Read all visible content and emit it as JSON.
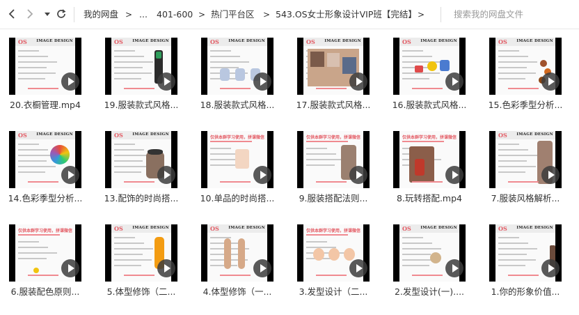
{
  "toolbar": {
    "back_icon": "chevron-left-icon",
    "forward_icon": "chevron-right-icon",
    "history_icon": "triangle-down-icon",
    "refresh_icon": "refresh-icon",
    "breadcrumbs": [
      "我的网盘",
      "...",
      "401-600",
      "热门平台区",
      "543.OS女士形象设计VIP班【完结】"
    ],
    "crumb_separator": ">",
    "search_placeholder": "搜索我的网盘文件"
  },
  "files": [
    {
      "name": "20.衣橱管理.mp4",
      "style": "os-table"
    },
    {
      "name": "19.服装款式风格...",
      "style": "os-dress"
    },
    {
      "name": "18.服装款式风格...",
      "style": "os-collars"
    },
    {
      "name": "17.服装款式风格...",
      "style": "os-collage"
    },
    {
      "name": "16.服装款式风格...",
      "style": "os-items"
    },
    {
      "name": "15.色彩季型分析...",
      "style": "os-palette"
    },
    {
      "name": "14.色彩季型分析...",
      "style": "os-wheel"
    },
    {
      "name": "13.配饰的时尚搭...",
      "style": "os-hat"
    },
    {
      "name": "10.单品的时尚搭...",
      "style": "red-banner-shirt"
    },
    {
      "name": "9.服装搭配法则...",
      "style": "red-banner-person"
    },
    {
      "name": "8.玩转搭配.mp4",
      "style": "red-banner-street"
    },
    {
      "name": "7.服装风格解析...",
      "style": "os-model"
    },
    {
      "name": "6.服装配色原则...",
      "style": "red-banner-dot"
    },
    {
      "name": "5.体型修饰（二...",
      "style": "os-figure"
    },
    {
      "name": "4.体型修饰（一...",
      "style": "os-bodies"
    },
    {
      "name": "3.发型设计（二...",
      "style": "red-banner-faces"
    },
    {
      "name": "2.发型设计(一)....",
      "style": "os-hair"
    },
    {
      "name": "1.你的形象价值...",
      "style": "os-text"
    }
  ],
  "slide_text": {
    "logo": "OS",
    "header": "IMAGE DESIGN",
    "banner": "仅供本群学习使用，拼课微信"
  },
  "colors": {
    "accent_red": "#e35a63",
    "play_button": "#3c3c3c",
    "thumb_letterbox": "#000000"
  }
}
